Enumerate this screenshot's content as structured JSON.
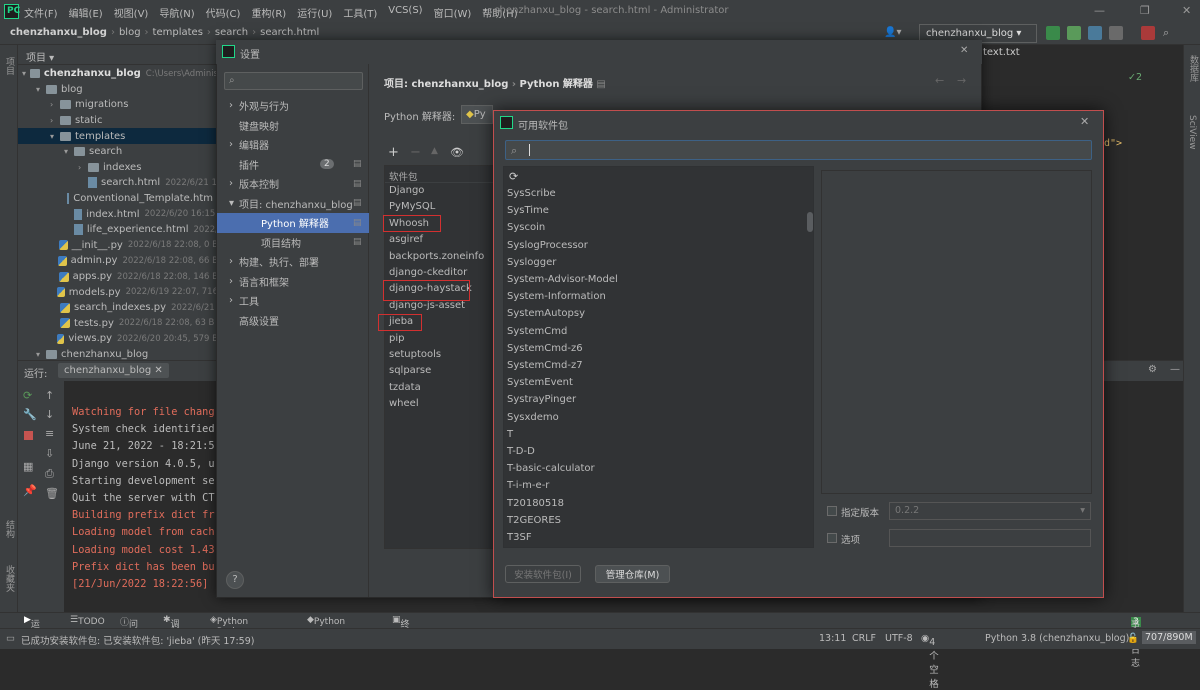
{
  "menu": [
    "文件(F)",
    "编辑(E)",
    "视图(V)",
    "导航(N)",
    "代码(C)",
    "重构(R)",
    "运行(U)",
    "工具(T)",
    "VCS(S)",
    "窗口(W)",
    "帮助(H)"
  ],
  "window_title": "chenzhanxu_blog - search.html - Administrator",
  "breadcrumbs": [
    "chenzhanxu_blog",
    "blog",
    "templates",
    "search",
    "search.html"
  ],
  "run_config": "chenzhanxu_blog",
  "editor_tab": "text.txt",
  "editor_snippet": "d\">",
  "inspection_count": "2",
  "project_panel": {
    "title": "项目",
    "tree": [
      {
        "name": "chenzhanxu_blog",
        "meta": "C:\\Users\\Adminis",
        "indent": 0,
        "type": "folder",
        "arrow": "▾"
      },
      {
        "name": "blog",
        "meta": "",
        "indent": 1,
        "type": "folder",
        "arrow": "▾"
      },
      {
        "name": "migrations",
        "meta": "",
        "indent": 2,
        "type": "folder",
        "arrow": "›"
      },
      {
        "name": "static",
        "meta": "",
        "indent": 2,
        "type": "folder",
        "arrow": "›"
      },
      {
        "name": "templates",
        "meta": "",
        "indent": 2,
        "type": "folder",
        "arrow": "▾",
        "selected": true
      },
      {
        "name": "search",
        "meta": "",
        "indent": 3,
        "type": "folder",
        "arrow": "▾"
      },
      {
        "name": "indexes",
        "meta": "",
        "indent": 4,
        "type": "folder",
        "arrow": "›"
      },
      {
        "name": "search.html",
        "meta": "2022/6/21 1",
        "indent": 4,
        "type": "file",
        "arrow": ""
      },
      {
        "name": "Conventional_Template.htm",
        "meta": "",
        "indent": 3,
        "type": "file",
        "arrow": ""
      },
      {
        "name": "index.html",
        "meta": "2022/6/20 16:15,",
        "indent": 3,
        "type": "file",
        "arrow": ""
      },
      {
        "name": "life_experience.html",
        "meta": "2022/",
        "indent": 3,
        "type": "file",
        "arrow": ""
      },
      {
        "name": "__init__.py",
        "meta": "2022/6/18 22:08, 0 B",
        "indent": 2,
        "type": "py",
        "arrow": ""
      },
      {
        "name": "admin.py",
        "meta": "2022/6/18 22:08, 66 B",
        "indent": 2,
        "type": "py",
        "arrow": ""
      },
      {
        "name": "apps.py",
        "meta": "2022/6/18 22:08, 146 B",
        "indent": 2,
        "type": "py",
        "arrow": ""
      },
      {
        "name": "models.py",
        "meta": "2022/6/19 22:07, 716",
        "indent": 2,
        "type": "py",
        "arrow": ""
      },
      {
        "name": "search_indexes.py",
        "meta": "2022/6/21",
        "indent": 2,
        "type": "py",
        "arrow": ""
      },
      {
        "name": "tests.py",
        "meta": "2022/6/18 22:08, 63 B",
        "indent": 2,
        "type": "py",
        "arrow": ""
      },
      {
        "name": "views.py",
        "meta": "2022/6/20 20:45, 579 B",
        "indent": 2,
        "type": "py",
        "arrow": ""
      },
      {
        "name": "chenzhanxu_blog",
        "meta": "",
        "indent": 1,
        "type": "folder",
        "arrow": "▾"
      }
    ]
  },
  "run_panel": {
    "label": "运行:",
    "tab": "chenzhanxu_blog",
    "lines": [
      {
        "text": "Watching for file chang",
        "color": "red"
      },
      {
        "text": "System check identified",
        "color": "normal"
      },
      {
        "text": "June 21, 2022 - 18:21:5",
        "color": "normal"
      },
      {
        "text": "Django version 4.0.5, u",
        "color": "normal"
      },
      {
        "text": "Starting development se",
        "color": "normal"
      },
      {
        "text": "Quit the server with CT",
        "color": "normal"
      },
      {
        "text": "Building prefix dict fr",
        "color": "red"
      },
      {
        "text": "Loading model from cach",
        "color": "red"
      },
      {
        "text": "Loading model cost 1.43",
        "color": "red"
      },
      {
        "text": "Prefix dict has been bu",
        "color": "red"
      },
      {
        "text": "[21/Jun/2022 18:22:56]",
        "color": "red"
      }
    ]
  },
  "side_labels": {
    "left_top": "项目",
    "left_mid": "结构",
    "left_bottom": "收藏夹",
    "right_top": "数据库",
    "right_mid": "SciView"
  },
  "settings": {
    "title": "设置",
    "nav": [
      {
        "label": "外观与行为",
        "arrow": "›",
        "indent": 0
      },
      {
        "label": "键盘映射",
        "arrow": "",
        "indent": 0
      },
      {
        "label": "编辑器",
        "arrow": "›",
        "indent": 0
      },
      {
        "label": "插件",
        "arrow": "",
        "indent": 0,
        "badge": "2"
      },
      {
        "label": "版本控制",
        "arrow": "›",
        "indent": 0
      },
      {
        "label": "项目: chenzhanxu_blog",
        "arrow": "▾",
        "indent": 0
      },
      {
        "label": "Python 解释器",
        "arrow": "",
        "indent": 1,
        "selected": true
      },
      {
        "label": "项目结构",
        "arrow": "",
        "indent": 1
      },
      {
        "label": "构建、执行、部署",
        "arrow": "›",
        "indent": 0
      },
      {
        "label": "语言和框架",
        "arrow": "›",
        "indent": 0
      },
      {
        "label": "工具",
        "arrow": "›",
        "indent": 0
      },
      {
        "label": "高级设置",
        "arrow": "",
        "indent": 0
      }
    ],
    "breadcrumb_project": "项目: chenzhanxu_blog",
    "breadcrumb_page": "Python 解释器",
    "interpreter_label": "Python 解释器:",
    "interpreter_value": "Py",
    "packages_header": "软件包",
    "packages": [
      "Django",
      "PyMySQL",
      "Whoosh",
      "asgiref",
      "backports.zoneinfo",
      "django-ckeditor",
      "django-haystack",
      "django-js-asset",
      "jieba",
      "pip",
      "setuptools",
      "sqlparse",
      "tzdata",
      "wheel"
    ],
    "help": "?"
  },
  "available": {
    "title": "可用软件包",
    "search_value": "",
    "items": [
      "SysScribe",
      "SysTime",
      "Syscoin",
      "SyslogProcessor",
      "Syslogger",
      "System-Advisor-Model",
      "System-Information",
      "SystemAutopsy",
      "SystemCmd",
      "SystemCmd-z6",
      "SystemCmd-z7",
      "SystemEvent",
      "SystrayPinger",
      "Sysxdemo",
      "T",
      "T-D-D",
      "T-basic-calculator",
      "T-i-m-e-r",
      "T20180518",
      "T2GEORES",
      "T3SF"
    ],
    "desc_label": "描述",
    "specify_version": "指定版本",
    "version_value": "0.2.2",
    "options": "选项",
    "install_button": "安装软件包(I)",
    "manage_button": "管理仓库(M)"
  },
  "bottom_tabs": [
    "运行",
    "TODO",
    "问题",
    "调试",
    "Python Packages",
    "Python 控制台",
    "终端"
  ],
  "event_log": "事件日志",
  "event_count": "3",
  "status": {
    "message": "已成功安装软件包: 已安装软件包: 'jieba' (昨天 17:59)",
    "position": "13:11",
    "line_ending": "CRLF",
    "encoding": "UTF-8",
    "indent": "4 个空格",
    "interpreter": "Python 3.8 (chenzhanxu_blog)",
    "memory": "707/890M"
  },
  "colors": {
    "accent": "#4b6eaf",
    "highlight_red": "#d23030",
    "green": "#21d789"
  }
}
